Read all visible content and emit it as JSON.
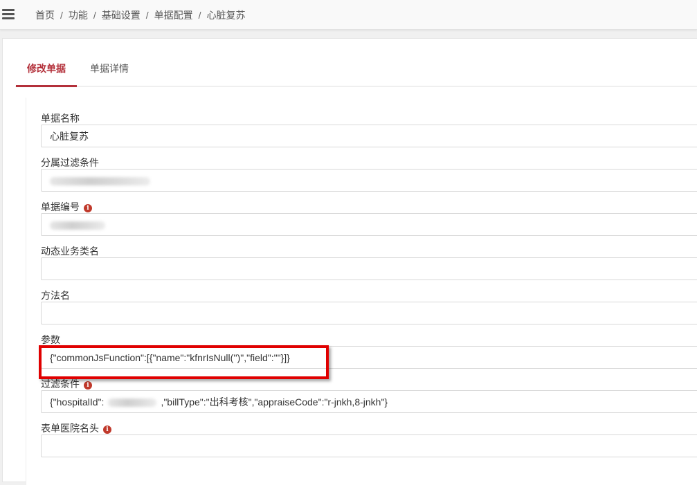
{
  "breadcrumb": {
    "items": [
      "首页",
      "功能",
      "基础设置",
      "单据配置",
      "心脏复苏"
    ],
    "separator": "/"
  },
  "tabs": {
    "active": "修改单据",
    "inactive": "单据详情"
  },
  "form": {
    "doc_name": {
      "label": "单据名称",
      "value": "心脏复苏"
    },
    "filter_affiliation": {
      "label": "分属过滤条件",
      "value": "",
      "redacted": true
    },
    "doc_code": {
      "label": "单据编号",
      "value": "",
      "redacted": true,
      "info_icon": "info-icon"
    },
    "dynamic_class": {
      "label": "动态业务类名",
      "value": ""
    },
    "method_name": {
      "label": "方法名",
      "value": ""
    },
    "params": {
      "label": "参数",
      "value": "{\"commonJsFunction\":[{\"name\":\"kfnrIsNull('')\",\"field\":\"\"}]}"
    },
    "filter_condition": {
      "label": "过滤条件",
      "info_icon": "info-icon",
      "value_prefix": "{\"hospitalId\":",
      "value_suffix": ",\"billType\":\"出科考核\",\"appraiseCode\":\"r-jnkh,8-jnkh\"}"
    },
    "hospital_header": {
      "label": "表单医院名头",
      "value": "",
      "info_icon": "info-icon"
    }
  },
  "colors": {
    "accent": "#b3303a",
    "highlight": "#e00000",
    "info": "#c0392b"
  }
}
